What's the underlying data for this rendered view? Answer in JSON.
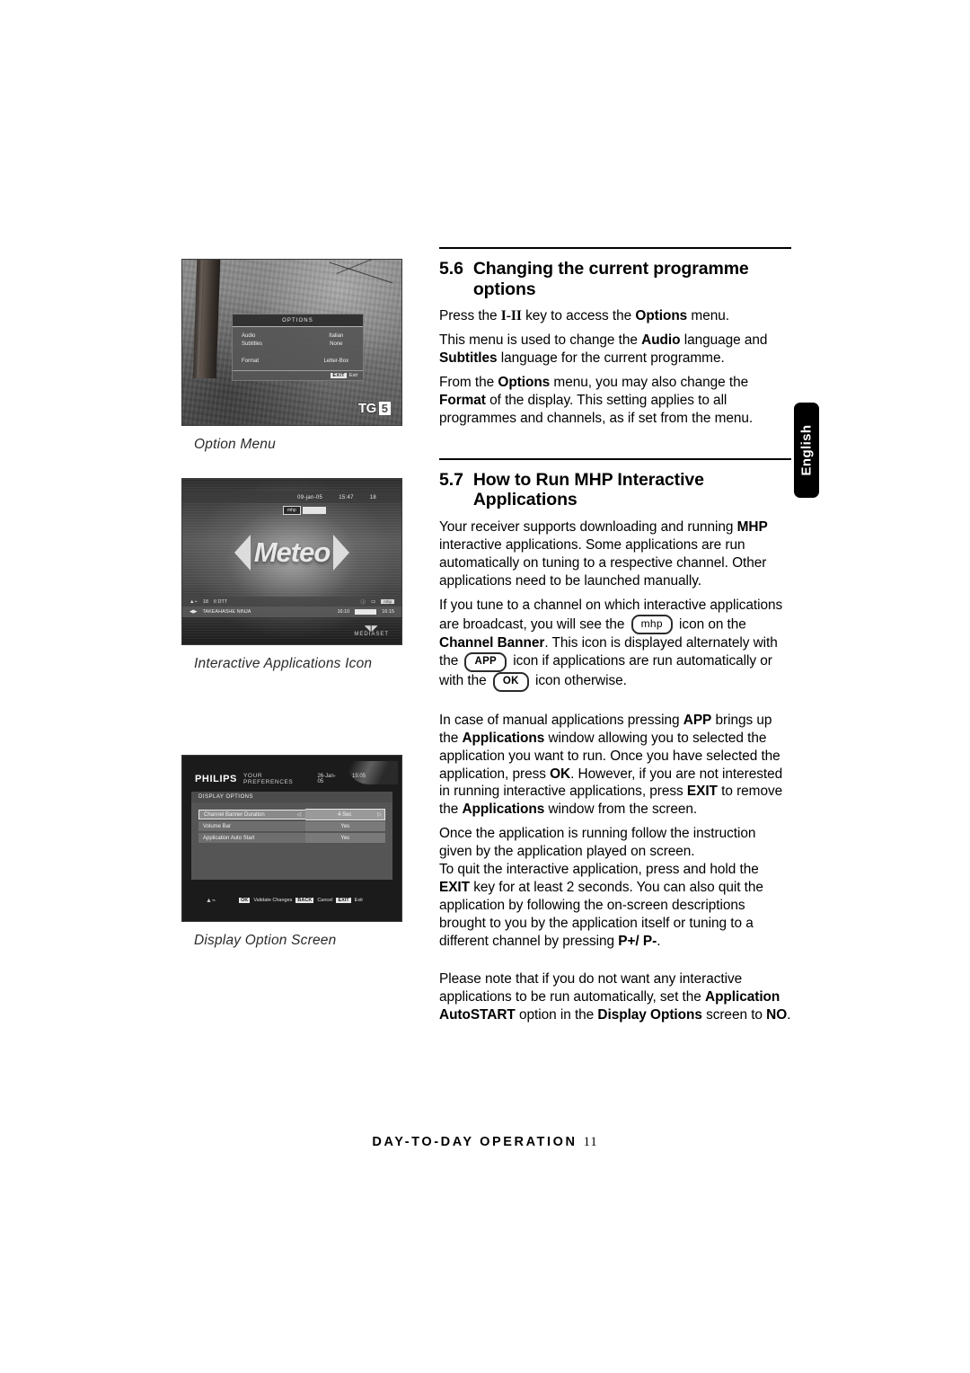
{
  "document": {
    "language_tab": "English",
    "footer_text": "DAY-TO-DAY OPERATION",
    "footer_page": "11"
  },
  "figures": [
    {
      "caption": "Option Menu",
      "screen": {
        "menu_title": "OPTIONS",
        "rows": [
          {
            "label": "Audio",
            "value": "Italian"
          },
          {
            "label": "Subtitles",
            "value": "None"
          },
          {
            "label": "Format",
            "value": "Letter-Box"
          }
        ],
        "footer_key": "EXIT",
        "footer_label": "Exit",
        "logo_text": "TG",
        "logo_number": "5"
      }
    },
    {
      "caption": "Interactive Applications Icon",
      "screen": {
        "top_date": "09-jan-05",
        "top_time": "15:47",
        "top_channel": "18",
        "mhp_tag": "mhp",
        "brand": "Meteo",
        "info_channel": "18",
        "info_type": "II DTT",
        "info_mhp": "mhp",
        "programme": "TAKEAHASHE NINJA",
        "start_time": "16:10",
        "end_time": "16:15",
        "broadcaster": "MEDIASET"
      }
    },
    {
      "caption": "Display Option Screen",
      "screen": {
        "brand": "PHILIPS",
        "brand_sub": "YOUR PREFERENCES",
        "date": "26-Jan-05",
        "time": "15:05",
        "section_title": "DISPLAY OPTIONS",
        "rows": [
          {
            "label": "Channel Banner Duration",
            "value": "4 Sec",
            "selected": true
          },
          {
            "label": "Volume Bar",
            "value": "Yes",
            "selected": false
          },
          {
            "label": "Application Auto Start",
            "value": "Yes",
            "selected": false
          }
        ],
        "footer": [
          {
            "key": "OK",
            "label": "Validate Changes"
          },
          {
            "key": "BACK",
            "label": "Cancel"
          },
          {
            "key": "EXIT",
            "label": "Exit"
          }
        ]
      }
    }
  ],
  "sections": [
    {
      "number": "5.6",
      "title": "Changing the current programme options",
      "paragraphs": [
        "Press the I-II key to access the Options menu.",
        "This menu is used to change the Audio language and Subtitles language for the current programme.",
        "From the Options menu, you may also change the Format of the display. This setting applies to all programmes and channels, as if set from the menu."
      ]
    },
    {
      "number": "5.7",
      "title": "How to Run MHP Interactive Applications",
      "paragraphs": [
        "Your receiver supports downloading and running MHP interactive applications. Some applications are run automatically on tuning to a respective channel. Other applications need to be launched manually.",
        "If you tune to a channel on which interactive applications are broadcast, you will see the mhp icon on the Channel Banner. This icon is displayed alternately with the APP icon if applications are run automatically or with the OK icon otherwise.",
        "In case of manual applications pressing APP brings up the Applications window allowing you to selected the application you want to run. Once you have selected the application, press OK. However, if you are not interested in running interactive applications, press EXIT to remove the Applications window from the screen.",
        "Once the application is running follow the instruction given by the application played on screen.",
        "To quit the interactive application, press and hold the EXIT key for at least 2 seconds. You can also quit the application by following the on-screen descriptions brought to you by the application itself or tuning to a different channel by pressing P+/ P-.",
        "Please note that if you do not want any interactive applications to be run automatically, set the Application AutoSTART option in the Display Options screen to NO."
      ],
      "inline_keys": {
        "mhp": "mhp",
        "app": "APP",
        "ok": "OK"
      }
    }
  ]
}
